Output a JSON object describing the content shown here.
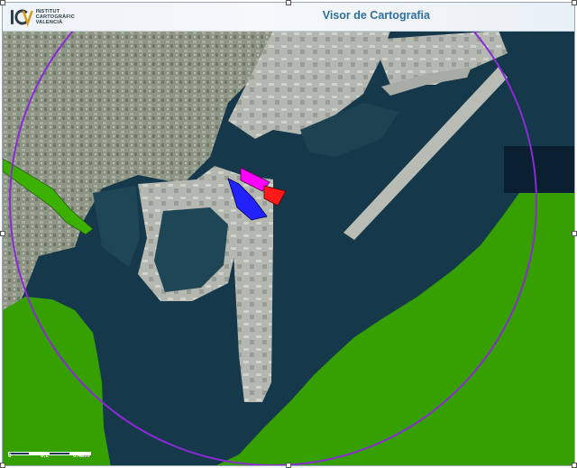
{
  "app": {
    "logo_lines": [
      "INSTITUT",
      "CARTOGRÀFIC",
      "VALENCIÀ"
    ],
    "title": "Visor de Cartografia"
  },
  "map": {
    "scale_labels": [
      "0",
      "0.2",
      "0.4km"
    ],
    "colors": {
      "sea": "#15384a",
      "land_green": "#35a000",
      "circle": "#8a2bd6",
      "polygon_blue": "#2222ff",
      "polygon_magenta": "#ff00ff",
      "polygon_red": "#ff1a1a",
      "wedge_green": "#3cb000"
    },
    "features": [
      "buffer-circle",
      "land-zone-east",
      "land-zone-southwest",
      "green-wedge",
      "blue-polygon",
      "magenta-polygon",
      "red-polygon"
    ]
  }
}
